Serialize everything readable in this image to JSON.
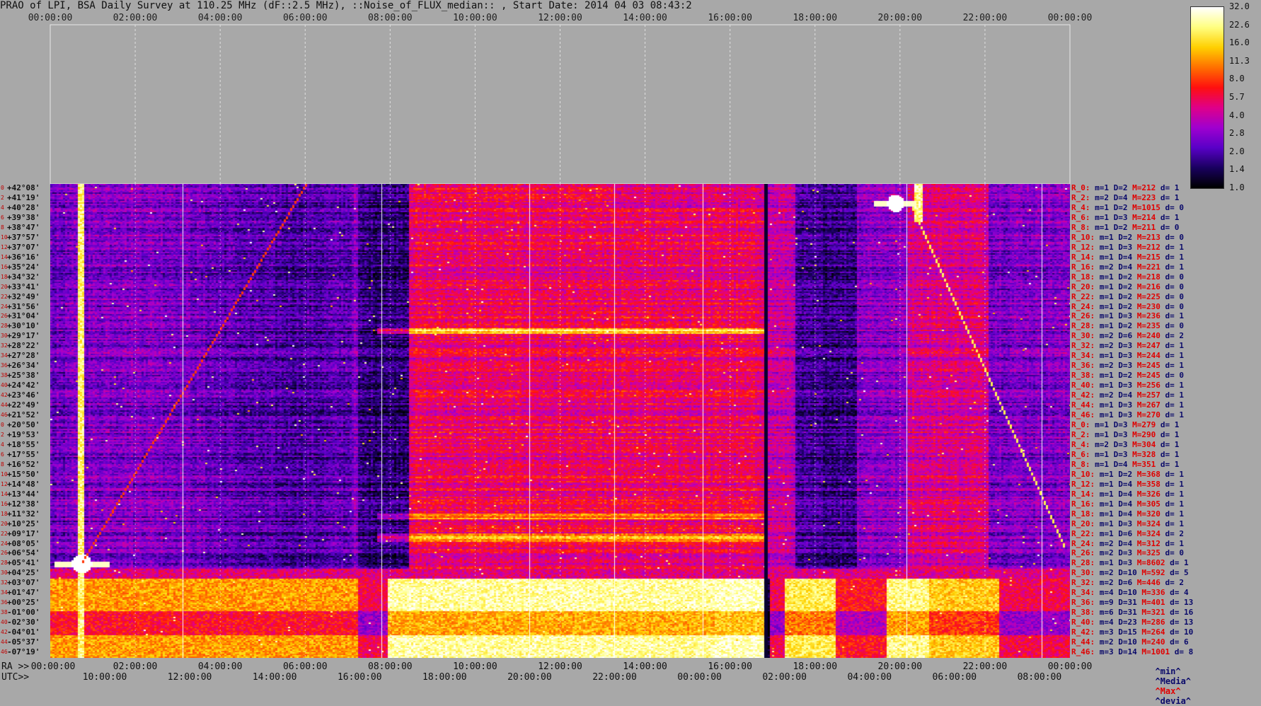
{
  "title": "PRAO of LPI, BSA Daily Survey at 110.25 MHz (dF::2.5 MHz), ::Noise_of_FLUX_median:: , Start Date: 2014 04 03 08:43:2",
  "chart_data": {
    "type": "heatmap",
    "title": "PRAO of LPI, BSA Daily Survey at 110.25 MHz (dF::2.5 MHz), ::Noise_of_FLUX_median:: , Start Date: 2014 04 03 08:43:2",
    "x_top_ticks": [
      "00:00:00",
      "02:00:00",
      "04:00:00",
      "06:00:00",
      "08:00:00",
      "10:00:00",
      "12:00:00",
      "14:00:00",
      "16:00:00",
      "18:00:00",
      "20:00:00",
      "22:00:00",
      "00:00:00"
    ],
    "x_ra_ticks": [
      "00:00:00",
      "02:00:00",
      "04:00:00",
      "06:00:00",
      "08:00:00",
      "10:00:00",
      "12:00:00",
      "14:00:00",
      "16:00:00",
      "18:00:00",
      "20:00:00",
      "22:00:00",
      "00:00:00"
    ],
    "x_utc_ticks": [
      "10:00:00",
      "12:00:00",
      "14:00:00",
      "16:00:00",
      "18:00:00",
      "20:00:00",
      "22:00:00",
      "00:00:00",
      "02:00:00",
      "04:00:00",
      "06:00:00",
      "08:00:00"
    ],
    "ra_prefix": "RA >>",
    "utc_prefix": "UTC>>",
    "y_labels": [
      "+42°08'",
      "+41°19'",
      "+40°28'",
      "+39°38'",
      "+38°47'",
      "+37°57'",
      "+37°07'",
      "+36°16'",
      "+35°24'",
      "+34°32'",
      "+33°41'",
      "+32°49'",
      "+31°56'",
      "+31°04'",
      "+30°10'",
      "+29°17'",
      "+28°22'",
      "+27°28'",
      "+26°34'",
      "+25°38'",
      "+24°42'",
      "+23°46'",
      "+22°49'",
      "+21°52'",
      "+20°50'",
      "+19°53'",
      "+18°55'",
      "+17°55'",
      "+16°52'",
      "+15°50'",
      "+14°48'",
      "+13°44'",
      "+12°38'",
      "+11°32'",
      "+10°25'",
      "+09°17'",
      "+08°05'",
      "+06°54'",
      "+05°41'",
      "+04°25'",
      "+03°07'",
      "+01°47'",
      "+00°25'",
      "-01°00'",
      "-02°30'",
      "-04°01'",
      "-05°37'",
      "-07°19'"
    ],
    "row_indices": [
      "0",
      "2",
      "4",
      "6",
      "8",
      "10",
      "12",
      "14",
      "16",
      "18",
      "20",
      "22",
      "24",
      "26",
      "28",
      "30",
      "32",
      "34",
      "36",
      "38",
      "40",
      "42",
      "44",
      "46",
      "0",
      "2",
      "4",
      "6",
      "8",
      "10",
      "12",
      "14",
      "16",
      "18",
      "20",
      "22",
      "24",
      "26",
      "28",
      "30",
      "32",
      "34",
      "36",
      "38",
      "40",
      "42",
      "44",
      "46"
    ],
    "row_stats": [
      {
        "r": "R_0:",
        "m": "m=1",
        "D": "D=2",
        "M": "M=212",
        "d": "d= 1"
      },
      {
        "r": "R_2:",
        "m": "m=2",
        "D": "D=4",
        "M": "M=223",
        "d": "d= 1"
      },
      {
        "r": "R_4:",
        "m": "m=1",
        "D": "D=2",
        "M": "M=1015",
        "d": "d= 0"
      },
      {
        "r": "R_6:",
        "m": "m=1",
        "D": "D=3",
        "M": "M=214",
        "d": "d= 1"
      },
      {
        "r": "R_8:",
        "m": "m=1",
        "D": "D=2",
        "M": "M=211",
        "d": "d= 0"
      },
      {
        "r": "R_10:",
        "m": "m=1",
        "D": "D=2",
        "M": "M=213",
        "d": "d= 0"
      },
      {
        "r": "R_12:",
        "m": "m=1",
        "D": "D=3",
        "M": "M=212",
        "d": "d= 1"
      },
      {
        "r": "R_14:",
        "m": "m=1",
        "D": "D=4",
        "M": "M=215",
        "d": "d= 1"
      },
      {
        "r": "R_16:",
        "m": "m=2",
        "D": "D=4",
        "M": "M=221",
        "d": "d= 1"
      },
      {
        "r": "R_18:",
        "m": "m=1",
        "D": "D=2",
        "M": "M=218",
        "d": "d= 0"
      },
      {
        "r": "R_20:",
        "m": "m=1",
        "D": "D=2",
        "M": "M=216",
        "d": "d= 0"
      },
      {
        "r": "R_22:",
        "m": "m=1",
        "D": "D=2",
        "M": "M=225",
        "d": "d= 0"
      },
      {
        "r": "R_24:",
        "m": "m=1",
        "D": "D=2",
        "M": "M=230",
        "d": "d= 0"
      },
      {
        "r": "R_26:",
        "m": "m=1",
        "D": "D=3",
        "M": "M=236",
        "d": "d= 1"
      },
      {
        "r": "R_28:",
        "m": "m=1",
        "D": "D=2",
        "M": "M=235",
        "d": "d= 0"
      },
      {
        "r": "R_30:",
        "m": "m=2",
        "D": "D=6",
        "M": "M=240",
        "d": "d= 2"
      },
      {
        "r": "R_32:",
        "m": "m=2",
        "D": "D=3",
        "M": "M=247",
        "d": "d= 1"
      },
      {
        "r": "R_34:",
        "m": "m=1",
        "D": "D=3",
        "M": "M=244",
        "d": "d= 1"
      },
      {
        "r": "R_36:",
        "m": "m=2",
        "D": "D=3",
        "M": "M=245",
        "d": "d= 1"
      },
      {
        "r": "R_38:",
        "m": "m=1",
        "D": "D=2",
        "M": "M=245",
        "d": "d= 0"
      },
      {
        "r": "R_40:",
        "m": "m=1",
        "D": "D=3",
        "M": "M=256",
        "d": "d= 1"
      },
      {
        "r": "R_42:",
        "m": "m=2",
        "D": "D=4",
        "M": "M=257",
        "d": "d= 1"
      },
      {
        "r": "R_44:",
        "m": "m=1",
        "D": "D=3",
        "M": "M=267",
        "d": "d= 1"
      },
      {
        "r": "R_46:",
        "m": "m=1",
        "D": "D=3",
        "M": "M=270",
        "d": "d= 1"
      },
      {
        "r": "R_0:",
        "m": "m=1",
        "D": "D=3",
        "M": "M=279",
        "d": "d= 1"
      },
      {
        "r": "R_2:",
        "m": "m=1",
        "D": "D=3",
        "M": "M=290",
        "d": "d= 1"
      },
      {
        "r": "R_4:",
        "m": "m=2",
        "D": "D=3",
        "M": "M=304",
        "d": "d= 1"
      },
      {
        "r": "R_6:",
        "m": "m=1",
        "D": "D=3",
        "M": "M=328",
        "d": "d= 1"
      },
      {
        "r": "R_8:",
        "m": "m=1",
        "D": "D=4",
        "M": "M=351",
        "d": "d= 1"
      },
      {
        "r": "R_10:",
        "m": "m=1",
        "D": "D=2",
        "M": "M=368",
        "d": "d= 1"
      },
      {
        "r": "R_12:",
        "m": "m=1",
        "D": "D=4",
        "M": "M=358",
        "d": "d= 1"
      },
      {
        "r": "R_14:",
        "m": "m=1",
        "D": "D=4",
        "M": "M=326",
        "d": "d= 1"
      },
      {
        "r": "R_16:",
        "m": "m=1",
        "D": "D=4",
        "M": "M=305",
        "d": "d= 1"
      },
      {
        "r": "R_18:",
        "m": "m=1",
        "D": "D=4",
        "M": "M=320",
        "d": "d= 1"
      },
      {
        "r": "R_20:",
        "m": "m=1",
        "D": "D=3",
        "M": "M=324",
        "d": "d= 1"
      },
      {
        "r": "R_22:",
        "m": "m=1",
        "D": "D=6",
        "M": "M=324",
        "d": "d= 2"
      },
      {
        "r": "R_24:",
        "m": "m=2",
        "D": "D=4",
        "M": "M=312",
        "d": "d= 1"
      },
      {
        "r": "R_26:",
        "m": "m=2",
        "D": "D=3",
        "M": "M=325",
        "d": "d= 0"
      },
      {
        "r": "R_28:",
        "m": "m=1",
        "D": "D=3",
        "M": "M=8602",
        "d": "d= 1"
      },
      {
        "r": "R_30:",
        "m": "m=2",
        "D": "D=10",
        "M": "M=592",
        "d": "d= 5"
      },
      {
        "r": "R_32:",
        "m": "m=2",
        "D": "D=6",
        "M": "M=446",
        "d": "d= 2"
      },
      {
        "r": "R_34:",
        "m": "m=4",
        "D": "D=10",
        "M": "M=336",
        "d": "d= 4"
      },
      {
        "r": "R_36:",
        "m": "m=9",
        "D": "D=31",
        "M": "M=401",
        "d": "d= 13"
      },
      {
        "r": "R_38:",
        "m": "m=6",
        "D": "D=31",
        "M": "M=321",
        "d": "d= 16"
      },
      {
        "r": "R_40:",
        "m": "m=4",
        "D": "D=23",
        "M": "M=286",
        "d": "d= 13"
      },
      {
        "r": "R_42:",
        "m": "m=3",
        "D": "D=15",
        "M": "M=264",
        "d": "d= 10"
      },
      {
        "r": "R_44:",
        "m": "m=2",
        "D": "D=10",
        "M": "M=240",
        "d": "d= 6"
      },
      {
        "r": "R_46:",
        "m": "m=3",
        "D": "D=14",
        "M": "M=1001",
        "d": "d= 8"
      }
    ],
    "legend_footer": {
      "min": "^min^",
      "median": "^Media^",
      "max": "^Max^",
      "dev": "^devia^"
    },
    "colorbar_ticks": [
      "32.0",
      "22.6",
      "16.0",
      "11.3",
      "8.0",
      "5.7",
      "4.0",
      "2.8",
      "2.0",
      "1.4",
      "1.0"
    ],
    "colorscale": [
      "#000000",
      "#1a0060",
      "#5a00c8",
      "#a000d0",
      "#e0008a",
      "#ff1010",
      "#ff7000",
      "#ffd000",
      "#ffff80",
      "#ffffff"
    ],
    "grid": "dashed"
  }
}
